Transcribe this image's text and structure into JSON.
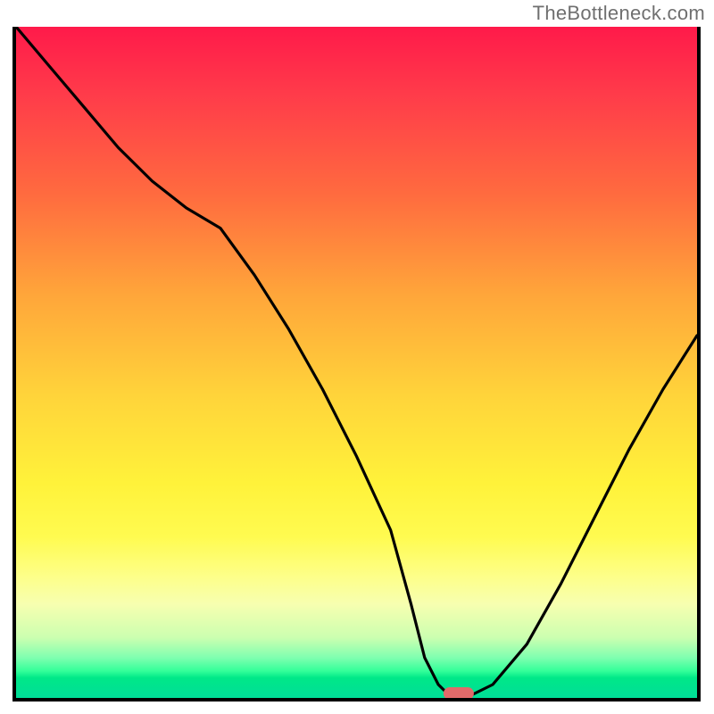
{
  "attribution": "TheBottleneck.com",
  "colors": {
    "gradient_top": "#ff1a4a",
    "gradient_bottom": "#00dd98",
    "curve": "#000000",
    "marker": "#e26a6a",
    "frame": "#000000"
  },
  "chart_data": {
    "type": "line",
    "title": "",
    "xlabel": "",
    "ylabel": "",
    "xlim": [
      0,
      100
    ],
    "ylim": [
      0,
      100
    ],
    "x": [
      0,
      5,
      10,
      15,
      20,
      25,
      30,
      35,
      40,
      45,
      50,
      55,
      58,
      60,
      62,
      64,
      66,
      70,
      75,
      80,
      85,
      90,
      95,
      100
    ],
    "values": [
      100,
      94,
      88,
      82,
      77,
      73,
      70,
      63,
      55,
      46,
      36,
      25,
      14,
      6,
      2,
      0,
      0,
      2,
      8,
      17,
      27,
      37,
      46,
      54
    ],
    "series": [
      {
        "name": "bottleneck-curve",
        "x": [
          0,
          5,
          10,
          15,
          20,
          25,
          30,
          35,
          40,
          45,
          50,
          55,
          58,
          60,
          62,
          64,
          66,
          70,
          75,
          80,
          85,
          90,
          95,
          100
        ],
        "values": [
          100,
          94,
          88,
          82,
          77,
          73,
          70,
          63,
          55,
          46,
          36,
          25,
          14,
          6,
          2,
          0,
          0,
          2,
          8,
          17,
          27,
          37,
          46,
          54
        ]
      }
    ],
    "marker": {
      "x": 65,
      "y": 0,
      "shape": "pill",
      "color": "#e26a6a"
    },
    "background": "vertical-gradient",
    "axes_visible": {
      "left": true,
      "right": true,
      "bottom": true,
      "top": false
    },
    "ticks_visible": false,
    "grid": false
  }
}
